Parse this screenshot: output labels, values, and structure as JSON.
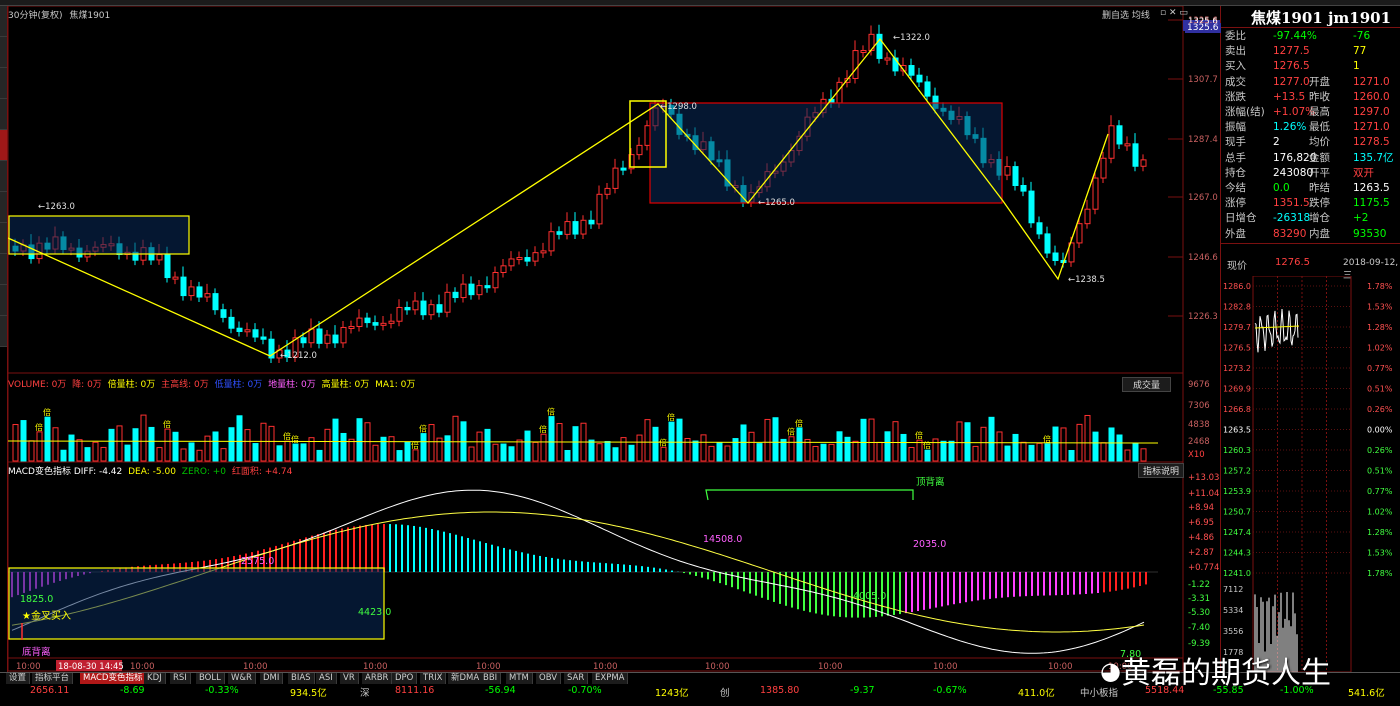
{
  "header": {
    "period_label": "30分钟(复权)",
    "symbol_short": "焦煤1901",
    "right_controls": "删自选 均线"
  },
  "colors": {
    "up": "#ff3030",
    "down": "#00ffff",
    "ma_line": "#ffff00",
    "annot": "#ffff00",
    "box_fill": "#0a2a5a",
    "box_red": "#e00000",
    "dea": "#ffff44",
    "diff": "#ffffff"
  },
  "price_axis": [
    "1328.1",
    "1325.6",
    "1307.7",
    "1287.4",
    "1267.0",
    "1246.6",
    "1226.3"
  ],
  "price_annotations": [
    "1263.0",
    "1212.0",
    "1298.0",
    "1265.0",
    "1322.0",
    "1238.5"
  ],
  "volume": {
    "legend": [
      {
        "text": "VOLUME: 0万",
        "color": "#ff4040"
      },
      {
        "text": "降: 0万",
        "color": "#ff4040"
      },
      {
        "text": "倍量柱: 0万",
        "color": "#ffff00"
      },
      {
        "text": "主高线: 0万",
        "color": "#ff4040"
      },
      {
        "text": "低量柱: 0万",
        "color": "#3050ff"
      },
      {
        "text": "地量柱: 0万",
        "color": "#ff60ff"
      },
      {
        "text": "高量柱: 0万",
        "color": "#ffff00"
      },
      {
        "text": "MA1: 0万",
        "color": "#ffff00"
      }
    ],
    "button": "成交量",
    "axis": [
      "9676",
      "7306",
      "4838",
      "2468",
      "X10"
    ],
    "marker_char": "倍"
  },
  "macd": {
    "legend": [
      {
        "text": "MACD变色指标 DIFF: -4.42",
        "color": "#ffffff"
      },
      {
        "text": "DEA: -5.00",
        "color": "#ffff00"
      },
      {
        "text": "ZERO: +0",
        "color": "#00c000"
      },
      {
        "text": "红面积: +4.74",
        "color": "#ff4040"
      }
    ],
    "button": "指标说明",
    "axis": [
      "+13.03",
      "+11.04",
      "+8.94",
      "+6.95",
      "+4.86",
      "+2.87",
      "+0.774",
      "-1.22",
      "-3.31",
      "-5.30",
      "-7.40",
      "-9.39"
    ],
    "labels": {
      "top_div": "顶背离",
      "bottom_div": "底背离",
      "gold_cross": "金叉买入",
      "area_a": "2575.0",
      "area_b": "1825.0",
      "area_c": "4423.0",
      "area_d": "14508.0",
      "area_e": "2035.0",
      "area_f": "4005.0",
      "area_g": "7.80"
    }
  },
  "time_axis": [
    "10:00",
    "18-08-30 14:45",
    "10:00",
    "10:00",
    "10:00",
    "10:00",
    "10:00",
    "10:00",
    "10:00",
    "10:00",
    "10:00",
    "10:00",
    "10:00"
  ],
  "quote": {
    "title": "焦煤1901 jm1901",
    "price_badge": "1325.6",
    "rows": [
      {
        "l": "委比",
        "v": "-97.44%",
        "l2": "",
        "v2": "-76",
        "c": "#00ff00",
        "c2": "#00ff00"
      },
      {
        "l": "卖出",
        "v": "1277.5",
        "l2": "",
        "v2": "77",
        "c": "#ff4040",
        "c2": "#ffff00"
      },
      {
        "l": "买入",
        "v": "1276.5",
        "l2": "",
        "v2": "1",
        "c": "#ff4040",
        "c2": "#ffff00"
      },
      {
        "l": "成交",
        "v": "1277.0",
        "l2": "开盘",
        "v2": "1271.0",
        "c": "#ff4040",
        "c2": "#ff4040"
      },
      {
        "l": "涨跌",
        "v": "+13.5",
        "l2": "昨收",
        "v2": "1260.0",
        "c": "#ff4040",
        "c2": "#ff4040"
      },
      {
        "l": "涨幅(结)",
        "v": "+1.07%",
        "l2": "最高",
        "v2": "1297.0",
        "c": "#ff4040",
        "c2": "#ff4040"
      },
      {
        "l": "振幅",
        "v": "1.26%",
        "l2": "最低",
        "v2": "1271.0",
        "c": "#00ffff",
        "c2": "#ff4040"
      },
      {
        "l": "现手",
        "v": "2",
        "l2": "均价",
        "v2": "1278.5",
        "c": "#ffffff",
        "c2": "#ff4040"
      },
      {
        "l": "总手",
        "v": "176,820",
        "l2": "金额",
        "v2": "135.7亿",
        "c": "#ffffff",
        "c2": "#00ffff"
      },
      {
        "l": "持仓",
        "v": "243080",
        "l2": "开平",
        "v2": "双开",
        "c": "#ffffff",
        "c2": "#ff4040"
      },
      {
        "l": "今结",
        "v": "0.0",
        "l2": "昨结",
        "v2": "1263.5",
        "c": "#00ff00",
        "c2": "#ffffff"
      },
      {
        "l": "涨停",
        "v": "1351.5",
        "l2": "跌停",
        "v2": "1175.5",
        "c": "#ff4040",
        "c2": "#00ff00"
      },
      {
        "l": "日增仓",
        "v": "-26318",
        "l2": "增仓",
        "v2": "+2",
        "c": "#00ffff",
        "c2": "#00ff00"
      },
      {
        "l": "外盘",
        "v": "83290",
        "l2": "内盘",
        "v2": "93530",
        "c": "#ff4040",
        "c2": "#00ff00"
      }
    ],
    "spot_label": "现价",
    "spot_value": "1276.5",
    "spot_date": "2018-09-12,三",
    "mini_axis_left": [
      "1286.0",
      "1282.8",
      "1279.7",
      "1276.5",
      "1273.2",
      "1269.9",
      "1266.8",
      "1263.5",
      "1260.3",
      "1257.2",
      "1253.9",
      "1250.7",
      "1247.4",
      "1244.3",
      "1241.0"
    ],
    "mini_axis_right": [
      "1.78%",
      "1.53%",
      "1.28%",
      "1.02%",
      "0.77%",
      "0.51%",
      "0.26%",
      "0.00%",
      "0.26%",
      "0.51%",
      "0.77%",
      "1.02%",
      "1.28%",
      "1.53%",
      "1.78%"
    ],
    "mini_vol_axis": [
      "7112",
      "5334",
      "3556",
      "1778"
    ]
  },
  "tabs": [
    "设置",
    "指标平台",
    "MACD变色指标",
    "KDJ",
    "RSI",
    "BOLL",
    "W&R",
    "DMI",
    "BIAS",
    "ASI",
    "VR",
    "ARBR",
    "DPO",
    "TRIX",
    "新DMA",
    "BBI",
    "MTM",
    "OBV",
    "SAR",
    "EXPMA"
  ],
  "ticker": [
    {
      "t": "2656.11",
      "c": "#ff4040"
    },
    {
      "t": "-8.69",
      "c": "#00ff00"
    },
    {
      "t": "-0.33%",
      "c": "#00ff00"
    },
    {
      "t": "934.5亿",
      "c": "#ffff00"
    },
    {
      "t": "深",
      "c": "#c8c8c8"
    },
    {
      "t": "8111.16",
      "c": "#ff4040"
    },
    {
      "t": "-56.94",
      "c": "#00ff00"
    },
    {
      "t": "-0.70%",
      "c": "#00ff00"
    },
    {
      "t": "1243亿",
      "c": "#ffff00"
    },
    {
      "t": "创",
      "c": "#c8c8c8"
    },
    {
      "t": "1385.80",
      "c": "#ff4040"
    },
    {
      "t": "-9.37",
      "c": "#00ff00"
    },
    {
      "t": "-0.67%",
      "c": "#00ff00"
    },
    {
      "t": "411.0亿",
      "c": "#ffff00"
    },
    {
      "t": "中小板指",
      "c": "#c8c8c8"
    },
    {
      "t": "5518.44",
      "c": "#ff4040"
    },
    {
      "t": "-55.85",
      "c": "#00ff00"
    },
    {
      "t": "-1.00%",
      "c": "#00ff00"
    },
    {
      "t": "541.6亿",
      "c": "#ffff00"
    }
  ],
  "watermark": "黄磊的期货人生"
}
